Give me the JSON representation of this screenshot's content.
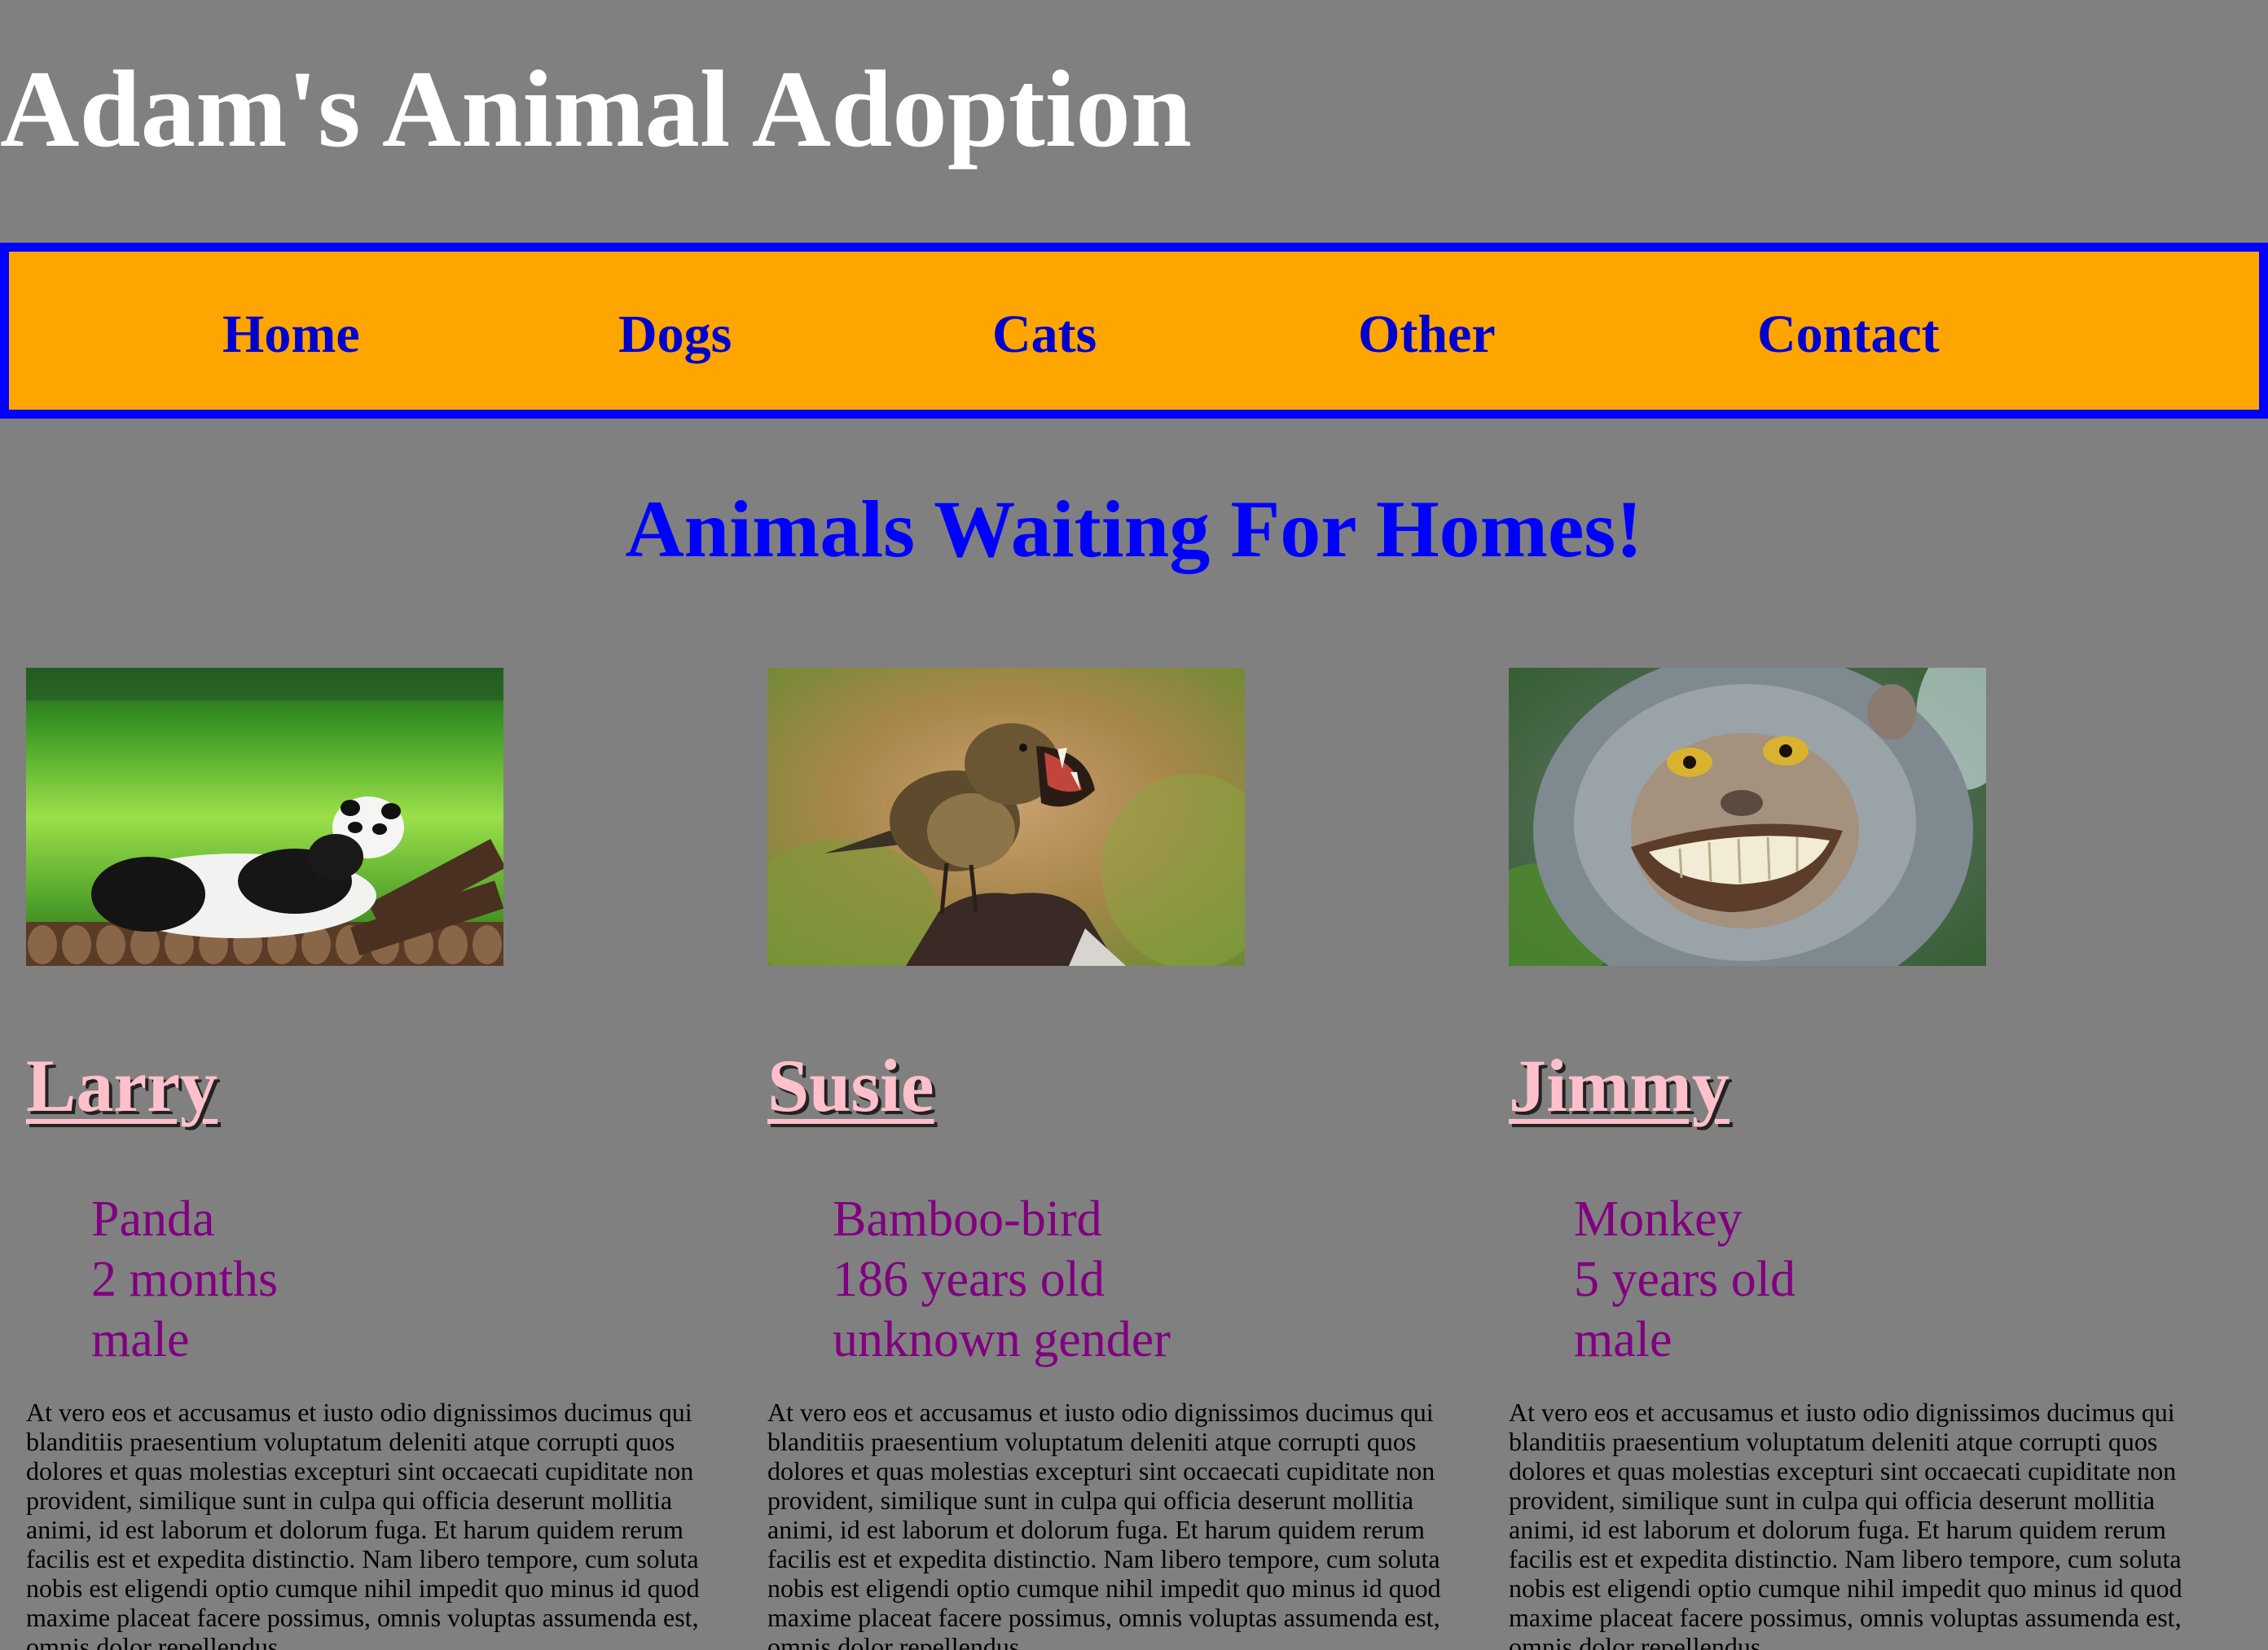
{
  "site": {
    "title": "Adam's Animal Adoption"
  },
  "nav": {
    "items": [
      {
        "label": "Home"
      },
      {
        "label": "Dogs"
      },
      {
        "label": "Cats"
      },
      {
        "label": "Other"
      },
      {
        "label": "Contact"
      }
    ]
  },
  "colors": {
    "page_background": "#808080",
    "nav_background": "#ffa500",
    "nav_border": "#0000ff",
    "heading": "#0000ff",
    "animal_name": "#ffc0cb",
    "details": "#800080"
  },
  "main": {
    "heading": "Animals Waiting For Homes!",
    "animals": [
      {
        "photo_subject": "panda-photo",
        "name": "Larry",
        "species": "Panda",
        "age": "2 months",
        "gender": "male",
        "description": "At vero eos et accusamus et iusto odio dignissimos ducimus qui blanditiis praesentium voluptatum deleniti atque corrupti quos dolores et quas molestias excepturi sint occaecati cupiditate non provident, similique sunt in culpa qui officia deserunt mollitia animi, id est laborum et dolorum fuga. Et harum quidem rerum facilis est et expedita distinctio. Nam libero tempore, cum soluta nobis est eligendi optio cumque nihil impedit quo minus id quod maxime placeat facere possimus, omnis voluptas assumenda est, omnis dolor repellendus."
      },
      {
        "photo_subject": "bird-photo",
        "name": "Susie",
        "species": "Bamboo-bird",
        "age": "186 years old",
        "gender": "unknown gender",
        "description": "At vero eos et accusamus et iusto odio dignissimos ducimus qui blanditiis praesentium voluptatum deleniti atque corrupti quos dolores et quas molestias excepturi sint occaecati cupiditate non provident, similique sunt in culpa qui officia deserunt mollitia animi, id est laborum et dolorum fuga. Et harum quidem rerum facilis est et expedita distinctio. Nam libero tempore, cum soluta nobis est eligendi optio cumque nihil impedit quo minus id quod maxime placeat facere possimus, omnis voluptas assumenda est, omnis dolor repellendus."
      },
      {
        "photo_subject": "monkey-photo",
        "name": "Jimmy",
        "species": "Monkey",
        "age": "5 years old",
        "gender": "male",
        "description": "At vero eos et accusamus et iusto odio dignissimos ducimus qui blanditiis praesentium voluptatum deleniti atque corrupti quos dolores et quas molestias excepturi sint occaecati cupiditate non provident, similique sunt in culpa qui officia deserunt mollitia animi, id est laborum et dolorum fuga. Et harum quidem rerum facilis est et expedita distinctio. Nam libero tempore, cum soluta nobis est eligendi optio cumque nihil impedit quo minus id quod maxime placeat facere possimus, omnis voluptas assumenda est, omnis dolor repellendus."
      }
    ]
  }
}
